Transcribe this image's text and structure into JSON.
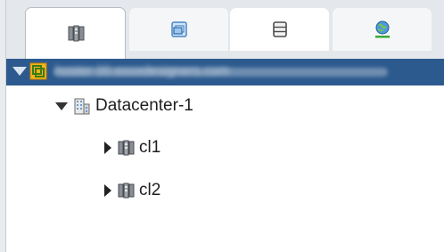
{
  "tabs": [
    {
      "icon": "hosts-clusters-icon",
      "active": true
    },
    {
      "icon": "vms-templates-icon",
      "active": false
    },
    {
      "icon": "storage-icon",
      "active": false
    },
    {
      "icon": "networking-icon",
      "active": false
    }
  ],
  "tree": {
    "root": {
      "label": "hoster 00.exxxdesigners.com",
      "icon": "vcenter-icon",
      "expanded": true,
      "selected": true,
      "blurred": true
    },
    "datacenter": {
      "label": "Datacenter-1",
      "icon": "datacenter-icon",
      "expanded": true
    },
    "clusters": [
      {
        "label": "cl1",
        "icon": "cluster-icon",
        "expanded": false
      },
      {
        "label": "cl2",
        "icon": "cluster-icon",
        "expanded": false
      }
    ]
  },
  "colors": {
    "selection": "#2c5a8e",
    "tab_strip": "#e4e7eb",
    "text": "#1e1e1e"
  }
}
